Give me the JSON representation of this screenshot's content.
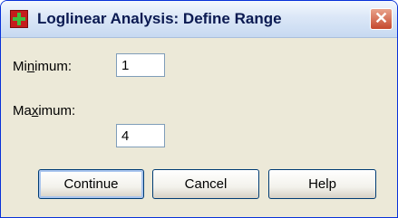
{
  "window": {
    "title": "Loglinear Analysis: Define Range",
    "close_symbol": "✕"
  },
  "form": {
    "min_label_pre": "Mi",
    "min_label_u": "n",
    "min_label_post": "imum:",
    "min_value": "1",
    "max_label_pre": "Ma",
    "max_label_u": "x",
    "max_label_post": "imum:",
    "max_value": "4"
  },
  "buttons": {
    "continue": "Continue",
    "cancel": "Cancel",
    "help": "Help"
  },
  "colors": {
    "title_text": "#0b1a52",
    "dialog_bg": "#ece9d8",
    "close_button": "#c5482e"
  }
}
